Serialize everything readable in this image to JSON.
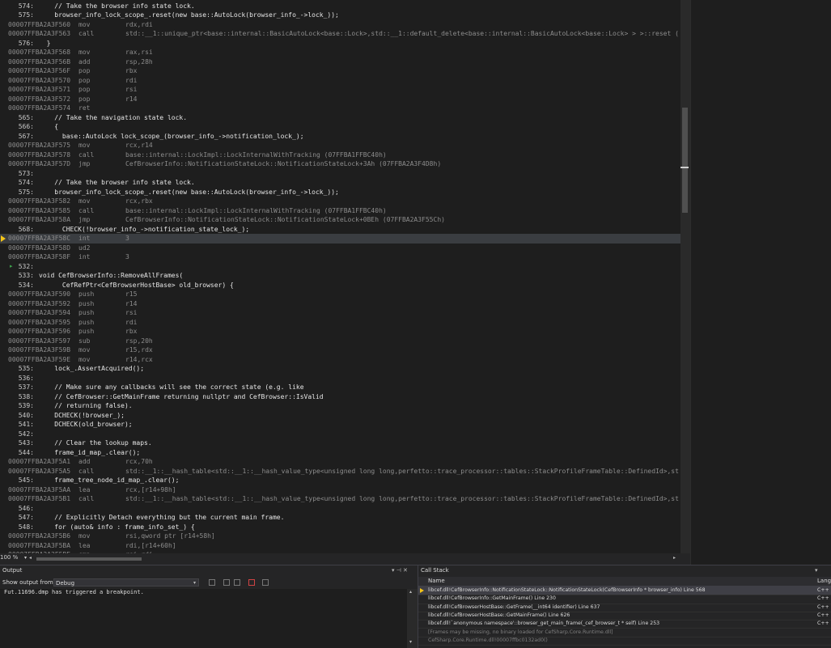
{
  "editor": {
    "zoom": "100 %",
    "lines": [
      {
        "k": "src",
        "ln": "574:",
        "t": "    // Take the browser info state lock."
      },
      {
        "k": "src",
        "ln": "575:",
        "t": "    browser_info_lock_scope_.reset(new base::AutoLock(browser_info_->lock_));"
      },
      {
        "k": "asm",
        "a": "00007FFBA2A3F560",
        "m": "mov",
        "o": "rdx,rdi"
      },
      {
        "k": "asm",
        "a": "00007FFBA2A3F563",
        "m": "call",
        "o": "std::__1::unique_ptr<base::internal::BasicAutoLock<base::Lock>,std::__1::default_delete<base::internal::BasicAutoLock<base::Lock> > >::reset ("
      },
      {
        "k": "src",
        "ln": "576:",
        "t": "  }"
      },
      {
        "k": "asm",
        "a": "00007FFBA2A3F568",
        "m": "mov",
        "o": "rax,rsi"
      },
      {
        "k": "asm",
        "a": "00007FFBA2A3F56B",
        "m": "add",
        "o": "rsp,28h"
      },
      {
        "k": "asm",
        "a": "00007FFBA2A3F56F",
        "m": "pop",
        "o": "rbx"
      },
      {
        "k": "asm",
        "a": "00007FFBA2A3F570",
        "m": "pop",
        "o": "rdi"
      },
      {
        "k": "asm",
        "a": "00007FFBA2A3F571",
        "m": "pop",
        "o": "rsi"
      },
      {
        "k": "asm",
        "a": "00007FFBA2A3F572",
        "m": "pop",
        "o": "r14"
      },
      {
        "k": "asm",
        "a": "00007FFBA2A3F574",
        "m": "ret",
        "o": ""
      },
      {
        "k": "src",
        "ln": "565:",
        "t": "    // Take the navigation state lock."
      },
      {
        "k": "src",
        "ln": "566:",
        "t": "    {"
      },
      {
        "k": "src",
        "ln": "567:",
        "t": "      base::AutoLock lock_scope_(browser_info_->notification_lock_);"
      },
      {
        "k": "asm",
        "a": "00007FFBA2A3F575",
        "m": "mov",
        "o": "rcx,r14"
      },
      {
        "k": "asm",
        "a": "00007FFBA2A3F578",
        "m": "call",
        "o": "base::internal::LockImpl::LockInternalWithTracking (07FFBA1FFBC40h)"
      },
      {
        "k": "asm",
        "a": "00007FFBA2A3F57D",
        "m": "jmp",
        "o": "CefBrowserInfo::NotificationStateLock::NotificationStateLock+3Ah (07FFBA2A3F4D8h)"
      },
      {
        "k": "src",
        "ln": "573:",
        "t": ""
      },
      {
        "k": "src",
        "ln": "574:",
        "t": "    // Take the browser info state lock."
      },
      {
        "k": "src",
        "ln": "575:",
        "t": "    browser_info_lock_scope_.reset(new base::AutoLock(browser_info_->lock_));"
      },
      {
        "k": "asm",
        "a": "00007FFBA2A3F582",
        "m": "mov",
        "o": "rcx,rbx"
      },
      {
        "k": "asm",
        "a": "00007FFBA2A3F585",
        "m": "call",
        "o": "base::internal::LockImpl::LockInternalWithTracking (07FFBA1FFBC40h)"
      },
      {
        "k": "asm",
        "a": "00007FFBA2A3F58A",
        "m": "jmp",
        "o": "CefBrowserInfo::NotificationStateLock::NotificationStateLock+0BEh (07FFBA2A3F55Ch)"
      },
      {
        "k": "src",
        "ln": "568:",
        "t": "      CHECK(!browser_info_->notification_state_lock_);"
      },
      {
        "k": "asm",
        "a": "00007FFBA2A3F58C",
        "m": "int",
        "o": "3",
        "cur": true
      },
      {
        "k": "asm",
        "a": "00007FFBA2A3F58D",
        "m": "ud2",
        "o": ""
      },
      {
        "k": "asm",
        "a": "00007FFBA2A3F58F",
        "m": "int",
        "o": "3"
      },
      {
        "k": "src",
        "ln": "532:",
        "t": "",
        "green": true
      },
      {
        "k": "src",
        "ln": "533:",
        "t": "void CefBrowserInfo::RemoveAllFrames("
      },
      {
        "k": "src",
        "ln": "534:",
        "t": "      CefRefPtr<CefBrowserHostBase> old_browser) {"
      },
      {
        "k": "asm",
        "a": "00007FFBA2A3F590",
        "m": "push",
        "o": "r15"
      },
      {
        "k": "asm",
        "a": "00007FFBA2A3F592",
        "m": "push",
        "o": "r14"
      },
      {
        "k": "asm",
        "a": "00007FFBA2A3F594",
        "m": "push",
        "o": "rsi"
      },
      {
        "k": "asm",
        "a": "00007FFBA2A3F595",
        "m": "push",
        "o": "rdi"
      },
      {
        "k": "asm",
        "a": "00007FFBA2A3F596",
        "m": "push",
        "o": "rbx"
      },
      {
        "k": "asm",
        "a": "00007FFBA2A3F597",
        "m": "sub",
        "o": "rsp,20h"
      },
      {
        "k": "asm",
        "a": "00007FFBA2A3F59B",
        "m": "mov",
        "o": "r15,rdx"
      },
      {
        "k": "asm",
        "a": "00007FFBA2A3F59E",
        "m": "mov",
        "o": "r14,rcx"
      },
      {
        "k": "src",
        "ln": "535:",
        "t": "    lock_.AssertAcquired();"
      },
      {
        "k": "src",
        "ln": "536:",
        "t": ""
      },
      {
        "k": "src",
        "ln": "537:",
        "t": "    // Make sure any callbacks will see the correct state (e.g. like"
      },
      {
        "k": "src",
        "ln": "538:",
        "t": "    // CefBrowser::GetMainFrame returning nullptr and CefBrowser::IsValid"
      },
      {
        "k": "src",
        "ln": "539:",
        "t": "    // returning false)."
      },
      {
        "k": "src",
        "ln": "540:",
        "t": "    DCHECK(!browser_);"
      },
      {
        "k": "src",
        "ln": "541:",
        "t": "    DCHECK(old_browser);"
      },
      {
        "k": "src",
        "ln": "542:",
        "t": ""
      },
      {
        "k": "src",
        "ln": "543:",
        "t": "    // Clear the lookup maps."
      },
      {
        "k": "src",
        "ln": "544:",
        "t": "    frame_id_map_.clear();"
      },
      {
        "k": "asm",
        "a": "00007FFBA2A3F5A1",
        "m": "add",
        "o": "rcx,70h"
      },
      {
        "k": "asm",
        "a": "00007FFBA2A3F5A5",
        "m": "call",
        "o": "std::__1::__hash_table<std::__1::__hash_value_type<unsigned long long,perfetto::trace_processor::tables::StackProfileFrameTable::DefinedId>,st"
      },
      {
        "k": "src",
        "ln": "545:",
        "t": "    frame_tree_node_id_map_.clear();"
      },
      {
        "k": "asm",
        "a": "00007FFBA2A3F5AA",
        "m": "lea",
        "o": "rcx,[r14+98h]"
      },
      {
        "k": "asm",
        "a": "00007FFBA2A3F5B1",
        "m": "call",
        "o": "std::__1::__hash_table<std::__1::__hash_value_type<unsigned long long,perfetto::trace_processor::tables::StackProfileFrameTable::DefinedId>,st"
      },
      {
        "k": "src",
        "ln": "546:",
        "t": ""
      },
      {
        "k": "src",
        "ln": "547:",
        "t": "    // Explicitly Detach everything but the current main frame."
      },
      {
        "k": "src",
        "ln": "548:",
        "t": "    for (auto& info : frame_info_set_) {"
      },
      {
        "k": "asm",
        "a": "00007FFBA2A3F5B6",
        "m": "mov",
        "o": "rsi,qword ptr [r14+58h]"
      },
      {
        "k": "asm",
        "a": "00007FFBA2A3F5BA",
        "m": "lea",
        "o": "rdi,[r14+60h]"
      },
      {
        "k": "asm",
        "a": "00007FFBA2A3F5BE",
        "m": "cmp",
        "o": "rsi,rdi"
      }
    ]
  },
  "output": {
    "title": "Output",
    "show_from_label": "Show output from:",
    "source": "Debug",
    "text": "Fut.11696.dmp has triggered a breakpoint."
  },
  "callstack": {
    "title": "Call Stack",
    "col_name": "Name",
    "col_lang": "Lang",
    "rows": [
      {
        "name": "libcef.dll!CefBrowserInfo::NotificationStateLock::NotificationStateLock(CefBrowserInfo * browser_info) Line 568",
        "lang": "C++",
        "cur": true
      },
      {
        "name": "libcef.dll!CefBrowserInfo::GetMainFrame() Line 230",
        "lang": "C++"
      },
      {
        "name": "libcef.dll!CefBrowserHostBase::GetFrame(__int64 identifier) Line 637",
        "lang": "C++"
      },
      {
        "name": "libcef.dll!CefBrowserHostBase::GetMainFrame() Line 626",
        "lang": "C++"
      },
      {
        "name": "libcef.dll!`anonymous namespace'::browser_get_main_frame(_cef_browser_t * self) Line 253",
        "lang": "C++"
      },
      {
        "name": "[Frames may be missing, no binary loaded for CefSharp.Core.Runtime.dll]",
        "lang": "",
        "dim": true
      },
      {
        "name": "CefSharp.Core.Runtime.dll!00007ffbc0132ad0()",
        "lang": "",
        "dim": true
      }
    ]
  }
}
